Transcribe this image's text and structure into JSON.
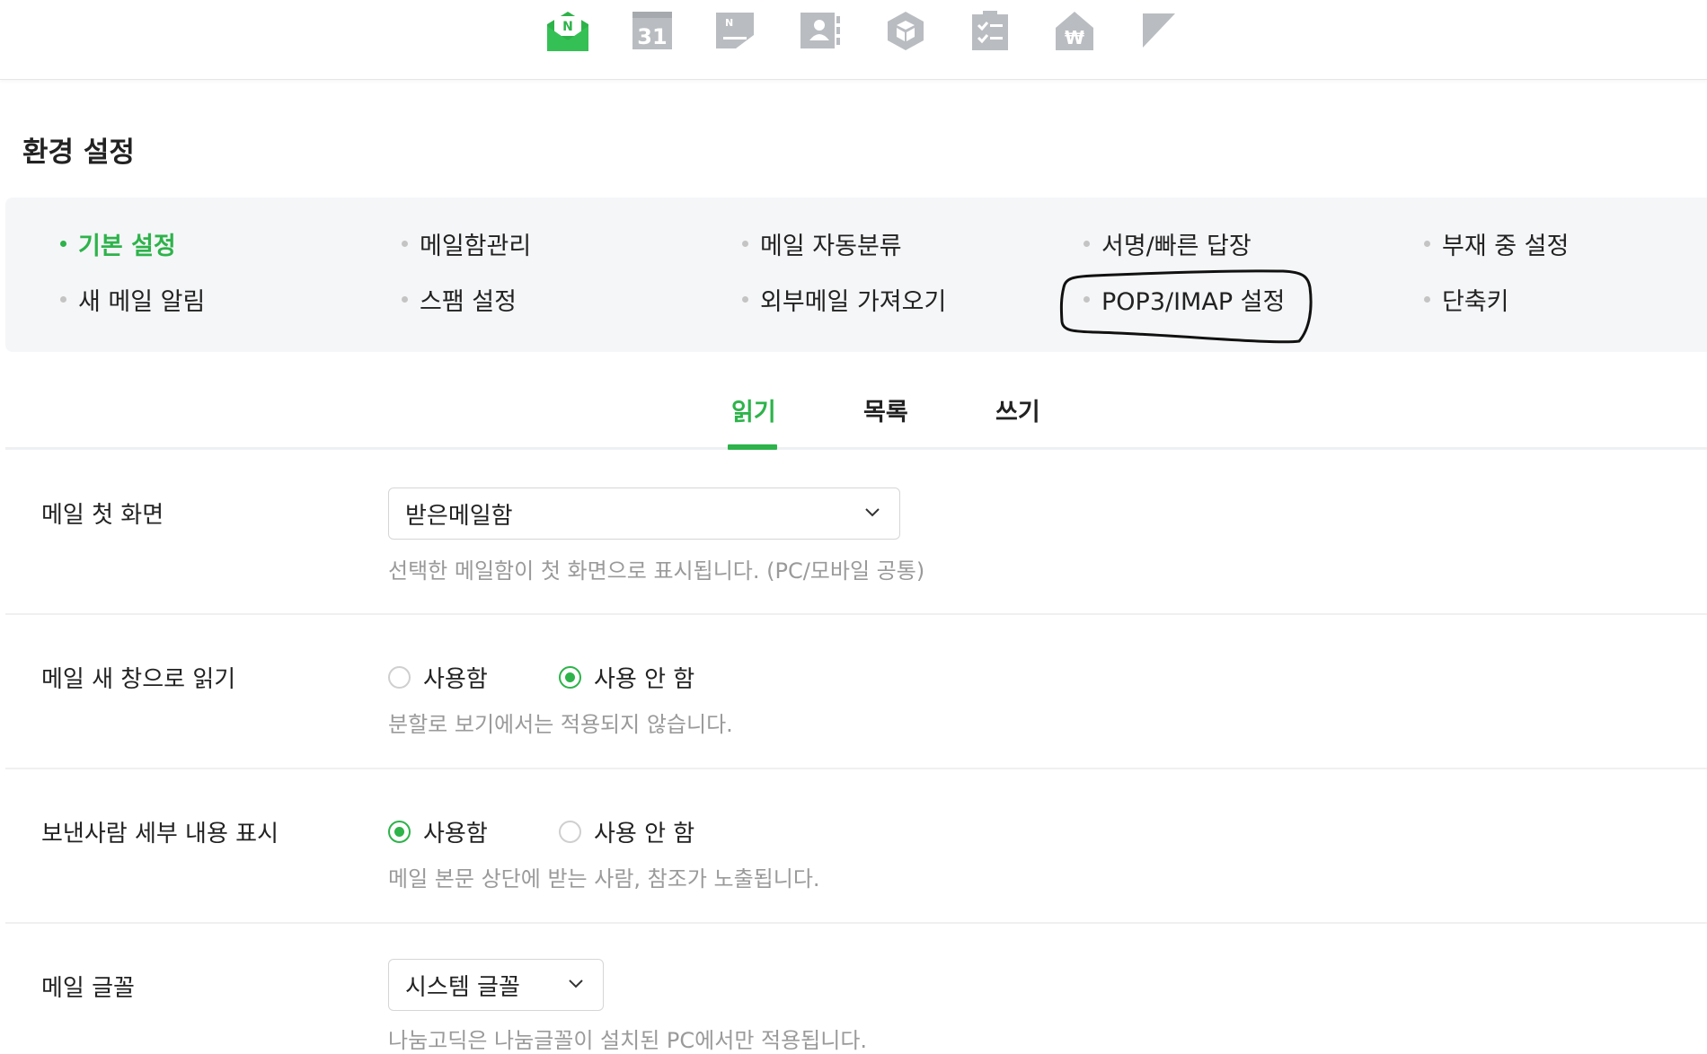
{
  "top_apps": [
    {
      "name": "mail-app-icon",
      "badge": "N"
    },
    {
      "name": "calendar-app-icon",
      "number": "31"
    },
    {
      "name": "note-app-icon",
      "badge": "N"
    },
    {
      "name": "contacts-app-icon"
    },
    {
      "name": "drive-app-icon"
    },
    {
      "name": "task-app-icon"
    },
    {
      "name": "household-ledger-app-icon",
      "symbol": "₩"
    },
    {
      "name": "bookmark-app-icon"
    }
  ],
  "page_title": "환경 설정",
  "settings_menu": {
    "row1": [
      "기본 설정",
      "메일함관리",
      "메일 자동분류",
      "서명/빠른 답장",
      "부재 중 설정"
    ],
    "row2": [
      "새 메일 알림",
      "스팸 설정",
      "외부메일 가져오기",
      "POP3/IMAP 설정",
      "단축키"
    ],
    "active": "기본 설정",
    "circled": "POP3/IMAP 설정"
  },
  "tabs": {
    "items": [
      "읽기",
      "목록",
      "쓰기"
    ],
    "active": "읽기"
  },
  "settings": {
    "first_screen": {
      "label": "메일 첫 화면",
      "value": "받은메일함",
      "hint": "선택한 메일함이 첫 화면으로 표시됩니다. (PC/모바일 공통)"
    },
    "new_window": {
      "label": "메일 새 창으로 읽기",
      "option_on": "사용함",
      "option_off": "사용 안 함",
      "selected": "사용 안 함",
      "hint": "분할로 보기에서는 적용되지 않습니다."
    },
    "sender_detail": {
      "label": "보낸사람 세부 내용 표시",
      "option_on": "사용함",
      "option_off": "사용 안 함",
      "selected": "사용함",
      "hint": "메일 본문 상단에 받는 사람, 참조가 노출됩니다."
    },
    "mail_font": {
      "label": "메일 글꼴",
      "value": "시스템 글꼴",
      "hint": "나눔고딕은 나눔글꼴이 설치된 PC에서만 적용됩니다."
    }
  },
  "colors": {
    "accent": "#2db34a",
    "menu_bg": "#f5f6f8",
    "icon_gray": "#b9bcc0"
  }
}
